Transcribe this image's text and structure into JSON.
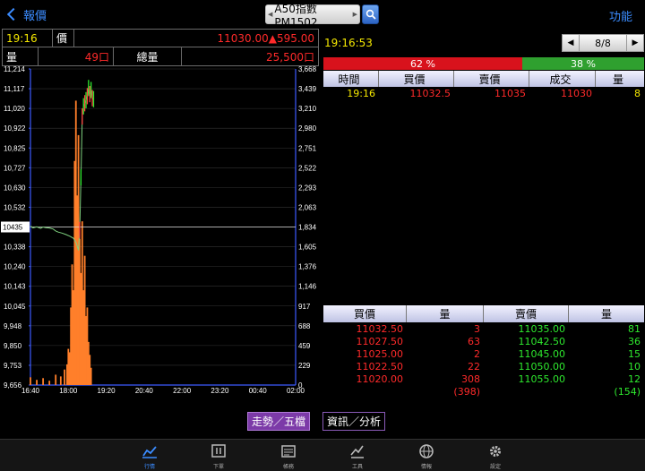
{
  "header": {
    "back_label": "報價",
    "symbol": "A50指數PM1502",
    "func_label": "功能"
  },
  "info": {
    "time": "19:16",
    "price_label": "價",
    "price_value": "11030.00▲595.00",
    "qty_label": "量",
    "qty_value": "49口",
    "total_label": "總量",
    "total_value": "25,500口"
  },
  "chart_data": {
    "type": "line",
    "x_ticks": [
      "16:40",
      "18:00",
      "19:20",
      "20:40",
      "22:00",
      "23:20",
      "00:40",
      "02:00"
    ],
    "y_left_ticks": [
      "11,214",
      "11,117",
      "11,020",
      "10,922",
      "10,825",
      "10,727",
      "10,630",
      "10,532",
      "10,435",
      "10,338",
      "10,240",
      "10,143",
      "10,045",
      "9,948",
      "9,850",
      "9,753",
      "9,656"
    ],
    "y_right_ticks": [
      "3,668",
      "3,439",
      "3,210",
      "2,980",
      "2,751",
      "2,522",
      "2,293",
      "2,063",
      "1,834",
      "1,605",
      "1,376",
      "1,146",
      "917",
      "688",
      "459",
      "229",
      "0"
    ],
    "ylim": [
      9656,
      11214
    ],
    "y2lim": [
      0,
      3668
    ],
    "reference_label": "10435",
    "reference_value": 10435,
    "price_series": {
      "x": [
        0,
        2,
        5,
        8,
        10,
        12,
        15,
        18,
        20,
        22,
        25,
        28,
        31,
        34,
        36,
        37,
        38,
        39,
        40,
        41,
        42,
        43,
        44,
        45,
        46,
        47,
        48,
        49,
        50
      ],
      "y": [
        10440,
        10430,
        10436,
        10428,
        10435,
        10432,
        10430,
        10425,
        10415,
        10410,
        10405,
        10398,
        10390,
        10380,
        10360,
        10340,
        10320,
        10420,
        10680,
        10980,
        11030,
        11045,
        11060,
        11080,
        11120,
        11090,
        11110,
        11070,
        11065
      ]
    },
    "volume_series": {
      "x": [
        0,
        5,
        10,
        15,
        20,
        24,
        27,
        29,
        30,
        31,
        32,
        33,
        34,
        35,
        36,
        37,
        38,
        39,
        40,
        41,
        42,
        43,
        44,
        45,
        46,
        47,
        48
      ],
      "y": [
        90,
        60,
        80,
        50,
        120,
        100,
        180,
        240,
        420,
        380,
        900,
        1400,
        1100,
        2600,
        3300,
        2200,
        2900,
        1700,
        1300,
        1900,
        1100,
        1500,
        800,
        900,
        500,
        350,
        200
      ]
    },
    "x_max": 210
  },
  "right": {
    "time": "19:16:53",
    "page": "8/8",
    "buy_ratio": "62 %",
    "sell_ratio": "38 %",
    "tick_headers": [
      "時間",
      "買價",
      "賣價",
      "成交",
      "量"
    ],
    "tick_row": [
      "19:16",
      "11032.5",
      "11035",
      "11030",
      "8"
    ],
    "book_headers": [
      "買價",
      "量",
      "賣價",
      "量"
    ],
    "book": [
      [
        "11032.50",
        "3",
        "11035.00",
        "81"
      ],
      [
        "11027.50",
        "63",
        "11042.50",
        "36"
      ],
      [
        "11025.00",
        "2",
        "11045.00",
        "15"
      ],
      [
        "11022.50",
        "22",
        "11050.00",
        "10"
      ],
      [
        "11020.00",
        "308",
        "11055.00",
        "12"
      ]
    ],
    "book_totals": [
      "(398)",
      "(154)"
    ]
  },
  "modes": {
    "trend": "走勢／五檔",
    "news": "資訊／分析"
  },
  "tabs": [
    "行情",
    "下單",
    "帳務",
    "工具",
    "情報",
    "設定"
  ],
  "colors": {
    "accent": "#3b8cff",
    "up": "#ff2a2a",
    "down": "#2ee82e",
    "time": "#f5e800",
    "volume": "#ff7f2a"
  }
}
